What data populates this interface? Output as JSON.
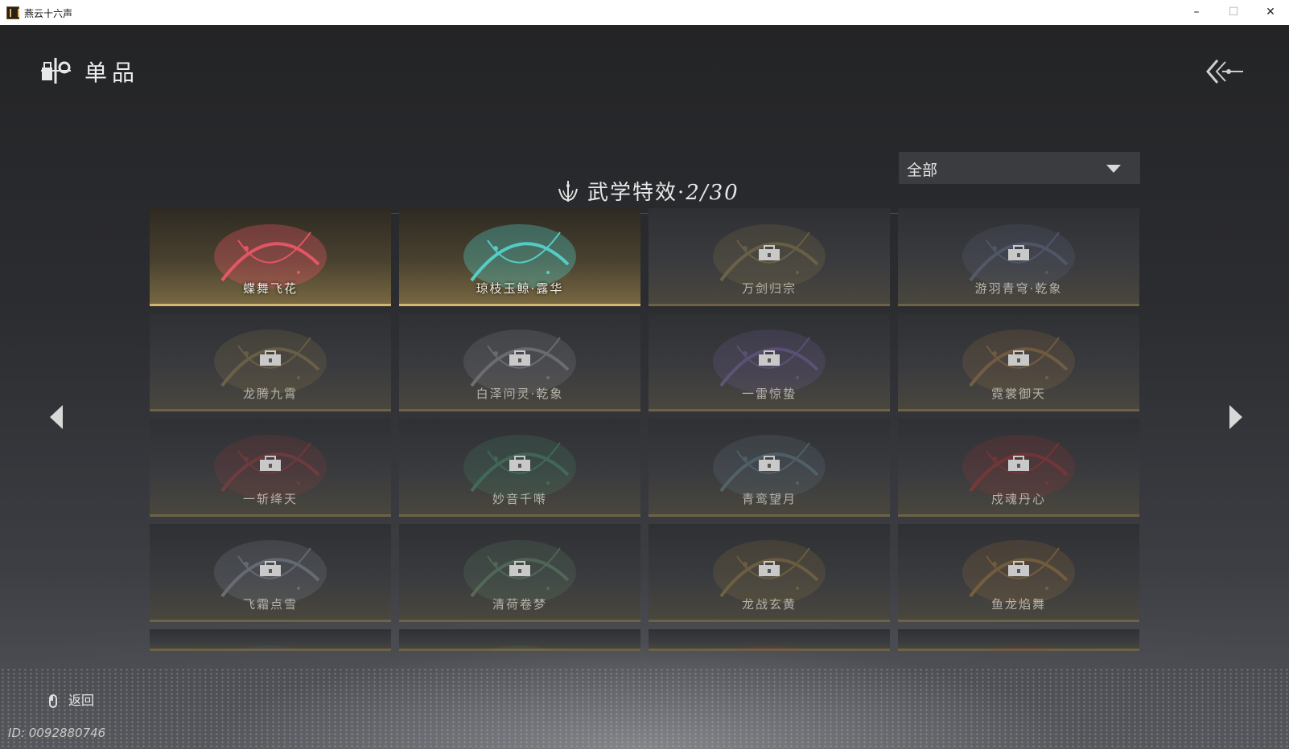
{
  "window": {
    "title": "燕云十六声",
    "minimize": "–",
    "maximize": "☐",
    "close": "✕"
  },
  "header": {
    "title": "单品",
    "icon": "store-icon",
    "back_icon": "back-arrows-icon"
  },
  "section": {
    "title": "武学特效·",
    "count": "2/30",
    "icon": "lotus-emblem-icon"
  },
  "filter": {
    "selected": "全部"
  },
  "items": [
    {
      "name": "蝶舞飞花",
      "unlocked": true,
      "accent": "#ff5a6e"
    },
    {
      "name": "琼枝玉鲸·露华",
      "unlocked": true,
      "accent": "#56e6e0"
    },
    {
      "name": "万剑归宗",
      "unlocked": false,
      "accent": "#bfa65a"
    },
    {
      "name": "游羽青穹·乾象",
      "unlocked": false,
      "accent": "#7c8db8"
    },
    {
      "name": "龙腾九霄",
      "unlocked": false,
      "accent": "#c2a45a"
    },
    {
      "name": "白泽问灵·乾象",
      "unlocked": false,
      "accent": "#c8c8d0"
    },
    {
      "name": "一雷惊蛰",
      "unlocked": false,
      "accent": "#9b7ce0"
    },
    {
      "name": "霓裳御天",
      "unlocked": false,
      "accent": "#d99a4c"
    },
    {
      "name": "一斩绛天",
      "unlocked": false,
      "accent": "#d04040"
    },
    {
      "name": "妙音千啭",
      "unlocked": false,
      "accent": "#4fbf8c"
    },
    {
      "name": "青鸾望月",
      "unlocked": false,
      "accent": "#7ea7b6"
    },
    {
      "name": "戍魂丹心",
      "unlocked": false,
      "accent": "#e03030"
    },
    {
      "name": "飞霜点雪",
      "unlocked": false,
      "accent": "#b8c4d8"
    },
    {
      "name": "清荷卷梦",
      "unlocked": false,
      "accent": "#7fb98a"
    },
    {
      "name": "龙战玄黄",
      "unlocked": false,
      "accent": "#c9a04a"
    },
    {
      "name": "鱼龙焰舞",
      "unlocked": false,
      "accent": "#e09a40"
    },
    {
      "name": "",
      "unlocked": false,
      "accent": "#5b6a9a"
    },
    {
      "name": "",
      "unlocked": false,
      "accent": "#6a8a5a"
    },
    {
      "name": "",
      "unlocked": false,
      "accent": "#a04040"
    },
    {
      "name": "",
      "unlocked": false,
      "accent": "#8a3030"
    }
  ],
  "footer": {
    "back_label": "返回",
    "id_text": "ID: 0092880746"
  }
}
